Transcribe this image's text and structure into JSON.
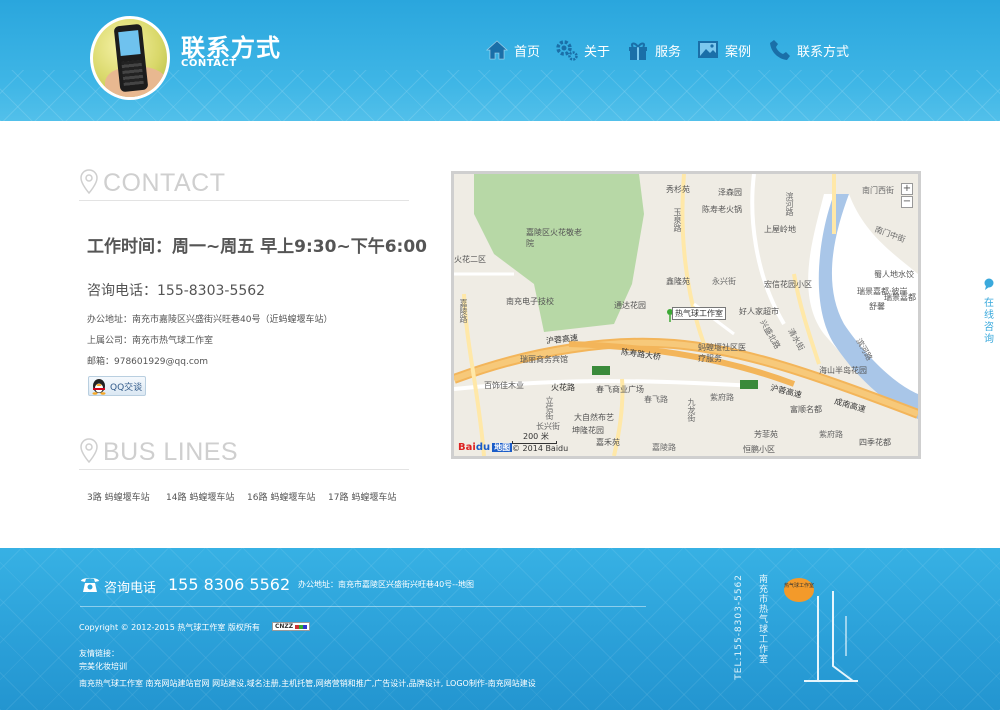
{
  "header": {
    "title": "联系方式",
    "subtitle": "CONTACT"
  },
  "nav": {
    "items": [
      {
        "label": "首页",
        "icon": "home-icon"
      },
      {
        "label": "关于",
        "icon": "gear-icon"
      },
      {
        "label": "服务",
        "icon": "gift-icon"
      },
      {
        "label": "案例",
        "icon": "picture-icon"
      },
      {
        "label": "联系方式",
        "icon": "phone-icon"
      }
    ]
  },
  "contact": {
    "heading": "CONTACT",
    "work_hours": "工作时间：周一~周五 早上9:30~下午6:00",
    "consult_phone": "咨询电话：155-8303-5562",
    "office_address": "办公地址：南充市嘉陵区兴盛街兴旺巷40号（近蚂蝗堰车站）",
    "parent_company": "上属公司：南充市热气球工作室",
    "email": "邮箱：978601929@qq.com",
    "qq_button": "QQ交谈"
  },
  "bus": {
    "heading": "BUS LINES",
    "lines": [
      "3路 蚂蝗堰车站",
      "14路 蚂蝗堰车站",
      "16路 蚂蝗堰车站",
      "17路 蚂蝗堰车站"
    ]
  },
  "map": {
    "marker_label": "热气球工作室",
    "zoom_in": "+",
    "zoom_out": "−",
    "scale": "200 米",
    "logo": "Bai",
    "logo_du": "du",
    "logo_ditu": "地图",
    "copyright": "© 2014 Baidu",
    "labels": [
      {
        "text": "秀杉苑",
        "cls": ""
      },
      {
        "text": "泽森园",
        "cls": ""
      },
      {
        "text": "陈寿老火锅",
        "cls": ""
      },
      {
        "text": "上屋岭地",
        "cls": ""
      },
      {
        "text": "滨河路",
        "cls": "road"
      },
      {
        "text": "南门西街",
        "cls": "road"
      },
      {
        "text": "南门中街",
        "cls": "road"
      },
      {
        "text": "嘉陵区火花敬老院",
        "cls": ""
      },
      {
        "text": "火花二区",
        "cls": ""
      },
      {
        "text": "南充电子技校",
        "cls": ""
      },
      {
        "text": "鑫隆苑",
        "cls": ""
      },
      {
        "text": "永兴街",
        "cls": "road"
      },
      {
        "text": "宏信花园小区",
        "cls": ""
      },
      {
        "text": "蜀人地水饺",
        "cls": ""
      },
      {
        "text": "瑞景嘉都·彼岸",
        "cls": ""
      },
      {
        "text": "舒馨",
        "cls": ""
      },
      {
        "text": "瑞景嘉都",
        "cls": ""
      },
      {
        "text": "通达花园",
        "cls": ""
      },
      {
        "text": "好人家超市",
        "cls": ""
      },
      {
        "text": "嘉陵路",
        "cls": "road"
      },
      {
        "text": "玉泉路",
        "cls": "road"
      },
      {
        "text": "沪蓉高速",
        "cls": "bold"
      },
      {
        "text": "陈寿路大桥",
        "cls": "bold"
      },
      {
        "text": "兴盛北路",
        "cls": "road"
      },
      {
        "text": "蚂蝗堰社区医疗服务",
        "cls": ""
      },
      {
        "text": "清水街",
        "cls": "road"
      },
      {
        "text": "瑞丽商务宾馆",
        "cls": ""
      },
      {
        "text": "海山半岛花园",
        "cls": ""
      },
      {
        "text": "滨河路",
        "cls": "road"
      },
      {
        "text": "百饰佳木业",
        "cls": ""
      },
      {
        "text": "火花路",
        "cls": "bold"
      },
      {
        "text": "春飞商业广场",
        "cls": ""
      },
      {
        "text": "沪蓉高速",
        "cls": "bold"
      },
      {
        "text": "成南高速",
        "cls": "bold"
      },
      {
        "text": "立信街",
        "cls": "road"
      },
      {
        "text": "春飞路",
        "cls": "road"
      },
      {
        "text": "紫府路",
        "cls": "road"
      },
      {
        "text": "富顺名都",
        "cls": ""
      },
      {
        "text": "大自然布艺",
        "cls": ""
      },
      {
        "text": "九龙街",
        "cls": "road"
      },
      {
        "text": "坤隆花园",
        "cls": ""
      },
      {
        "text": "芳菲苑",
        "cls": ""
      },
      {
        "text": "长兴街",
        "cls": "road"
      },
      {
        "text": "嘉禾苑",
        "cls": ""
      },
      {
        "text": "恒鹏小区",
        "cls": ""
      },
      {
        "text": "紫府路",
        "cls": "road"
      },
      {
        "text": "四季花都",
        "cls": ""
      },
      {
        "text": "嘉陵路",
        "cls": "road"
      }
    ]
  },
  "side_tab": {
    "label": "在线咨询"
  },
  "footer": {
    "phone_label": "咨询电话",
    "phone_number": "155 8306 5562",
    "address": "办公地址：南充市嘉陵区兴盛街兴旺巷40号--地图",
    "copyright": "Copyright © 2012-2015 热气球工作室 版权所有",
    "cnzz": "CNZZ",
    "links_title": "友情链接：",
    "link_1": "完美化妆培训",
    "link_2": "南充热气球工作室 南充网站建站官网 网站建设,域名注册,主机托管,网络营销和推广,广告设计,品牌设计, LOGO制作-南充网站建设",
    "deco_tel": "TEL:155-8303-5562",
    "deco_name": "南充市热气球工作室",
    "deco_stamp": "热气球工作室"
  }
}
